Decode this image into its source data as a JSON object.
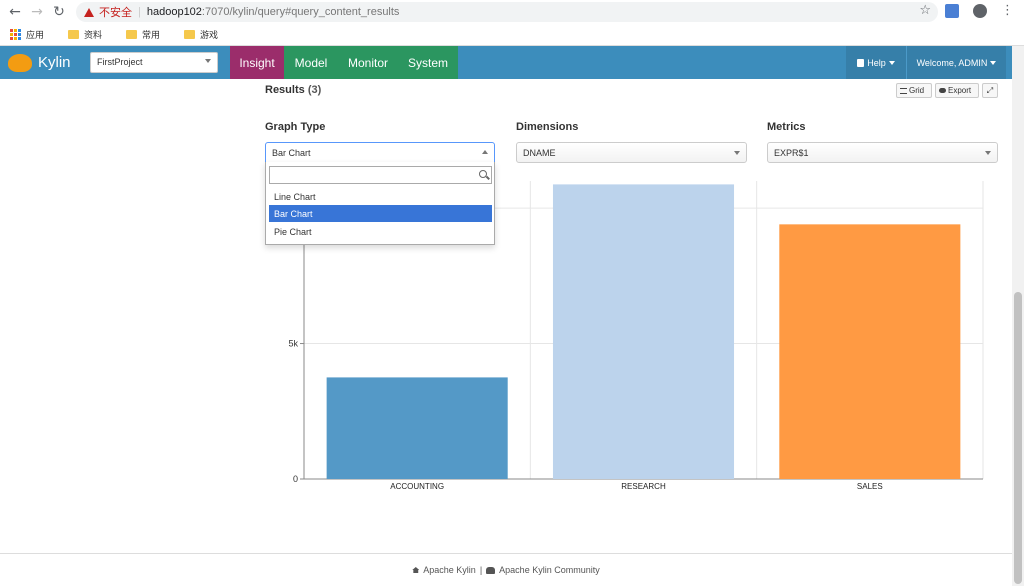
{
  "browser": {
    "security_label": "不安全",
    "url_host": "hadoop102",
    "url_rest": ":7070/kylin/query#query_content_results",
    "bookmarks": [
      "应用",
      "资料",
      "常用",
      "游戏"
    ]
  },
  "navbar": {
    "brand": "Kylin",
    "project": "FirstProject",
    "tabs": [
      "Insight",
      "Model",
      "Monitor",
      "System"
    ],
    "help": "Help",
    "welcome": "Welcome, ADMIN"
  },
  "results": {
    "title": "Results",
    "count": "(3)",
    "grid_label": "Grid",
    "export_label": "Export"
  },
  "selectors": {
    "graph_type_label": "Graph Type",
    "graph_type_value": "Bar Chart",
    "dimensions_label": "Dimensions",
    "dimensions_value": "DNAME",
    "metrics_label": "Metrics",
    "metrics_value": "EXPR$1",
    "graph_options": [
      "Line Chart",
      "Bar Chart",
      "Pie Chart"
    ],
    "selected_option": "Bar Chart"
  },
  "chart_data": {
    "type": "bar",
    "categories": [
      "ACCOUNTING",
      "RESEARCH",
      "SALES"
    ],
    "values": [
      3750,
      10875,
      9400
    ],
    "colors": [
      "#5499c7",
      "#bcd3ec",
      "#ff9a43"
    ],
    "ytick_labels": [
      "0",
      "5k"
    ],
    "yticks": [
      0,
      5000,
      10000
    ],
    "ylim": [
      0,
      11000
    ],
    "grid": true
  },
  "footer": {
    "link1": "Apache Kylin",
    "divider": "|",
    "link2": "Apache Kylin Community"
  }
}
